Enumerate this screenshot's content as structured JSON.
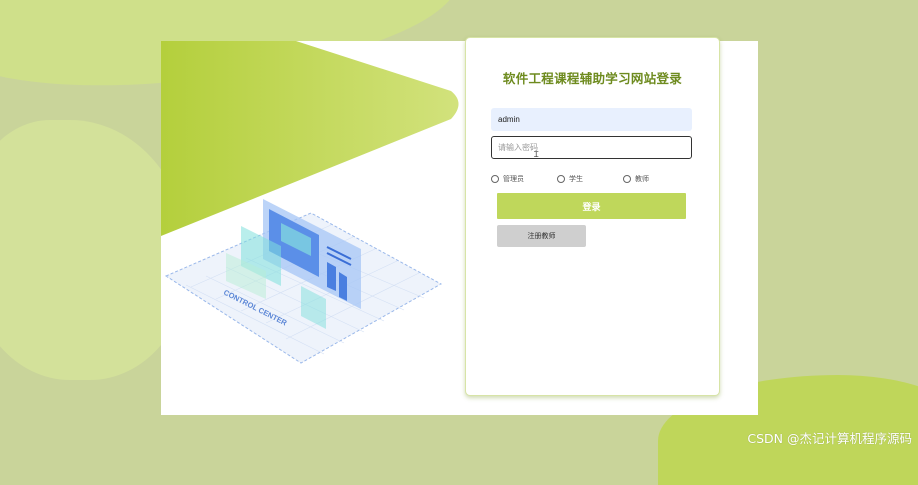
{
  "login": {
    "title": "软件工程课程辅助学习网站登录",
    "username_value": "admin",
    "password_placeholder": "请输入密码",
    "roles": [
      "管理员",
      "学生",
      "教师"
    ],
    "login_button": "登录",
    "register_button": "注册教师"
  },
  "illustration": {
    "label": "CONTROL CENTER"
  },
  "watermark": "CSDN @杰记计算机程序源码",
  "colors": {
    "accent": "#bfd75b",
    "title": "#6e8b1f",
    "background": "#c9d49a"
  }
}
